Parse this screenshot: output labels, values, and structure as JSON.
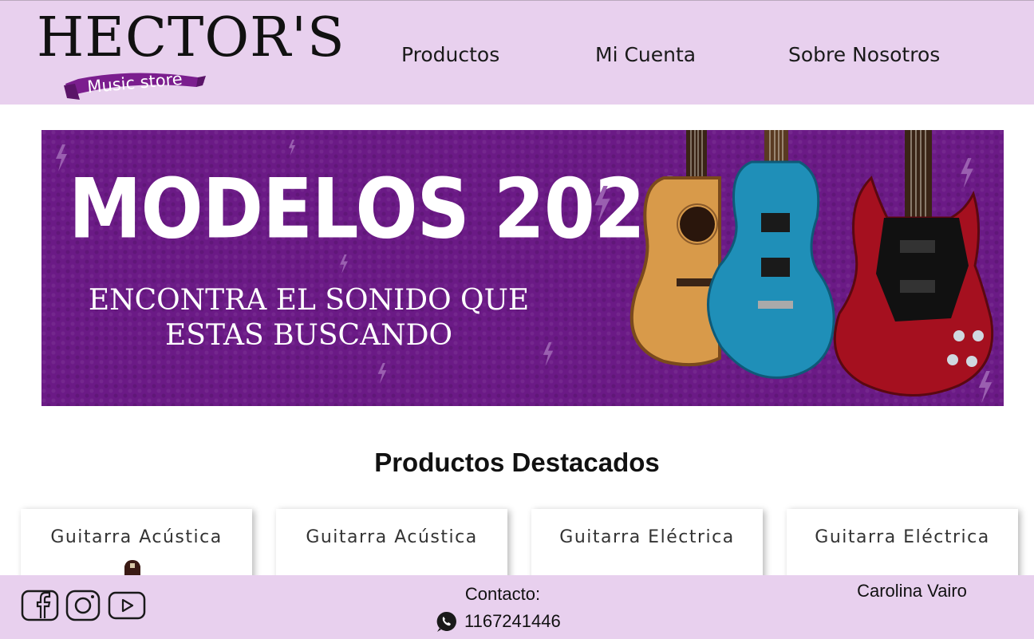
{
  "brand": {
    "name": "HECTOR'S",
    "subtitle": "Music store",
    "ribbon_color": "#7b1e8e"
  },
  "nav": {
    "items": [
      {
        "label": "Productos"
      },
      {
        "label": "Mi Cuenta"
      },
      {
        "label": "Sobre Nosotros"
      }
    ]
  },
  "banner": {
    "title": "MODELOS 2020",
    "subtitle": "ENCONTRA EL SONIDO QUE\nESTAS BUSCANDO",
    "background": "#6b1a86",
    "guitars": [
      "acoustic guitar",
      "blue electric guitar",
      "red SG electric guitar"
    ]
  },
  "featured": {
    "title": "Productos Destacados",
    "cards": [
      {
        "title": "Guitarra Acústica"
      },
      {
        "title": "Guitarra Acústica"
      },
      {
        "title": "Guitarra Eléctrica"
      },
      {
        "title": "Guitarra Eléctrica"
      }
    ]
  },
  "footer": {
    "social": [
      "facebook-icon",
      "instagram-icon",
      "youtube-icon"
    ],
    "contact_label": "Contacto:",
    "phone": "1167241446",
    "author": "Carolina Vairo",
    "background": "#e8d0ee"
  }
}
